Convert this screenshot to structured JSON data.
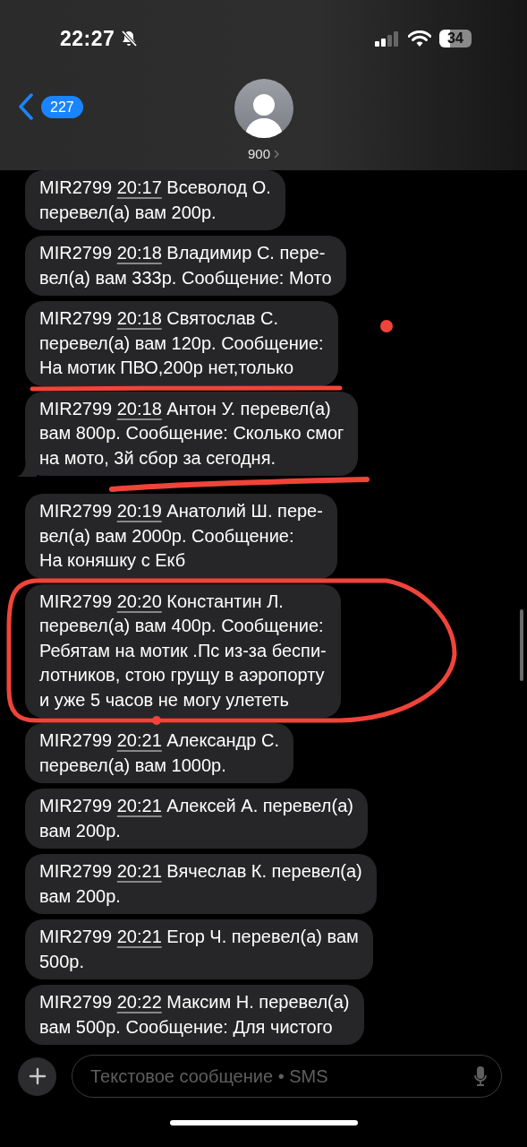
{
  "status_bar": {
    "time": "22:27",
    "silent": true,
    "battery": "34"
  },
  "header": {
    "back_count": "227",
    "contact": "900"
  },
  "messages": [
    {
      "sender": "MIR2799",
      "time": "20:17",
      "lines": [
        "Всеволод О.",
        "перевел(а) вам 200р."
      ],
      "tail": false
    },
    {
      "sender": "MIR2799",
      "time": "20:18",
      "lines": [
        "Владимир С. пере-",
        "вел(а) вам 333р. Сообщение: Мото"
      ],
      "tail": false
    },
    {
      "sender": "MIR2799",
      "time": "20:18",
      "lines": [
        "Святослав С.",
        "перевел(а) вам 120р. Сообщение:",
        "На мотик ПВО,200р нет,только"
      ],
      "tail": false
    },
    {
      "sender": "MIR2799",
      "time": "20:18",
      "lines": [
        "Антон У. перевел(а)",
        "вам 800р. Сообщение: Сколько смог",
        "на мото, 3й сбор за сегодня."
      ],
      "tail": true
    },
    {
      "sender": "MIR2799",
      "time": "20:19",
      "lines": [
        "Анатолий Ш. пере-",
        "вел(а) вам 2000р. Сообщение:",
        "На коняшку с Екб"
      ],
      "tail": false
    },
    {
      "sender": "MIR2799",
      "time": "20:20",
      "lines": [
        "Константин Л.",
        "перевел(а) вам 400р. Сообщение:",
        "Ребятам на мотик .Пс из-за беспи-",
        "лотников, стою грущу в аэропорту",
        "и уже 5 часов не могу улететь"
      ],
      "tail": false
    },
    {
      "sender": "MIR2799",
      "time": "20:21",
      "lines": [
        "Александр С.",
        "перевел(а) вам 1000р."
      ],
      "tail": false
    },
    {
      "sender": "MIR2799",
      "time": "20:21",
      "lines": [
        "Алексей А. перевел(а)",
        "вам 200р."
      ],
      "tail": false
    },
    {
      "sender": "MIR2799",
      "time": "20:21",
      "lines": [
        "Вячеслав К. перевел(а)",
        "вам 200р."
      ],
      "tail": false
    },
    {
      "sender": "MIR2799",
      "time": "20:21",
      "lines": [
        "Егор Ч. перевел(а) вам",
        "500р."
      ],
      "tail": false
    },
    {
      "sender": "MIR2799",
      "time": "20:22",
      "lines": [
        "Максим Н. перевел(а)",
        "вам 500р. Сообщение: Для чистого"
      ],
      "tail": false
    }
  ],
  "composer": {
    "placeholder": "Текстовое сообщение • SMS"
  }
}
